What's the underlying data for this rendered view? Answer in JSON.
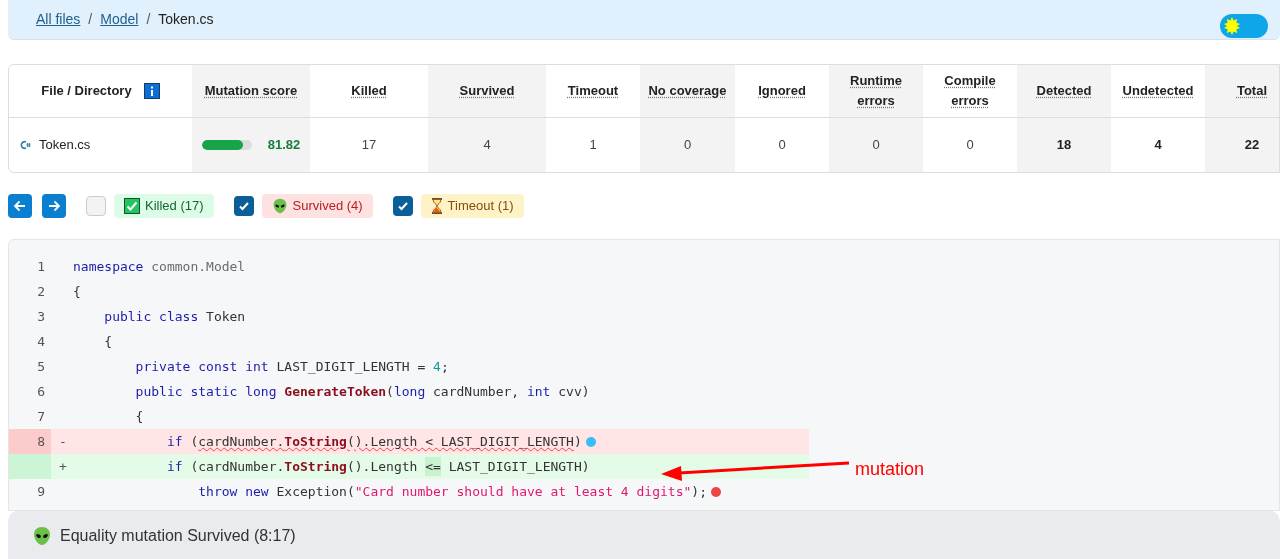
{
  "breadcrumb": [
    {
      "kind": "link",
      "label": "All files"
    },
    {
      "kind": "separator",
      "label": "/"
    },
    {
      "kind": "link",
      "label": "Model"
    },
    {
      "kind": "separator",
      "label": "/"
    },
    {
      "kind": "current",
      "label": "Token.cs"
    }
  ],
  "theme_toggle": {
    "dark": false
  },
  "table": {
    "columns": [
      {
        "label": "File / Directory",
        "info_icon": true
      },
      {
        "label": "Mutation score",
        "info_icon": false
      },
      {
        "label": "Killed",
        "info_icon": false
      },
      {
        "label": "Survived",
        "info_icon": false
      },
      {
        "label": "Timeout",
        "info_icon": false
      },
      {
        "label": "No coverage",
        "info_icon": false
      },
      {
        "label": "Ignored",
        "info_icon": false
      },
      {
        "label": "Runtime errors",
        "info_icon": false
      },
      {
        "label": "Compile errors",
        "info_icon": false
      },
      {
        "label": "Detected",
        "info_icon": false
      },
      {
        "label": "Undetected",
        "info_icon": false
      },
      {
        "label": "Total",
        "info_icon": false
      }
    ],
    "rows": [
      {
        "cells": [
          {
            "kind": "file",
            "text": "Token.cs"
          },
          {
            "kind": "score",
            "text": "81.82",
            "level": 0.8182
          },
          {
            "kind": "count",
            "text": "17",
            "bold": false
          },
          {
            "kind": "count",
            "text": "4",
            "bold": false
          },
          {
            "kind": "count",
            "text": "1",
            "bold": false
          },
          {
            "kind": "count",
            "text": "0",
            "bold": false
          },
          {
            "kind": "count",
            "text": "0",
            "bold": false
          },
          {
            "kind": "count",
            "text": "0",
            "bold": false
          },
          {
            "kind": "count",
            "text": "0",
            "bold": false
          },
          {
            "kind": "count",
            "text": "18",
            "bold": true
          },
          {
            "kind": "count",
            "text": "4",
            "bold": true
          },
          {
            "kind": "count",
            "text": "22",
            "bold": true
          }
        ]
      }
    ]
  },
  "filters": [
    {
      "kind": "killed",
      "label": "Killed (17)",
      "checked": false
    },
    {
      "kind": "survived",
      "label": "Survived (4)",
      "checked": true
    },
    {
      "kind": "timeout",
      "label": "Timeout (1)",
      "checked": true
    }
  ],
  "code": [
    {
      "kind": "context",
      "number": "1",
      "tokens": [
        {
          "text": "namespace",
          "kind": "kw"
        },
        {
          "text": " common.Model",
          "kind": "ns"
        }
      ]
    },
    {
      "kind": "context",
      "number": "2",
      "tokens": [
        {
          "text": "{",
          "kind": "plain"
        }
      ]
    },
    {
      "kind": "context",
      "number": "3",
      "tokens": [
        {
          "text": "    public class",
          "kind": "kw"
        },
        {
          "text": " Token",
          "kind": "plain"
        }
      ]
    },
    {
      "kind": "context",
      "number": "4",
      "tokens": [
        {
          "text": "    {",
          "kind": "plain"
        }
      ]
    },
    {
      "kind": "context",
      "number": "5",
      "tokens": [
        {
          "text": "        private const int",
          "kind": "kw"
        },
        {
          "text": " LAST_DIGIT_LENGTH = ",
          "kind": "plain"
        },
        {
          "text": "4",
          "kind": "num"
        },
        {
          "text": ";",
          "kind": "plain"
        }
      ]
    },
    {
      "kind": "context",
      "number": "6",
      "tokens": [
        {
          "text": "        public static long ",
          "kind": "kw"
        },
        {
          "text": "GenerateToken",
          "kind": "fn"
        },
        {
          "text": "(",
          "kind": "plain"
        },
        {
          "text": "long",
          "kind": "kw"
        },
        {
          "text": " cardNumber, ",
          "kind": "plain"
        },
        {
          "text": "int",
          "kind": "kw"
        },
        {
          "text": " cvv)",
          "kind": "plain"
        }
      ]
    },
    {
      "kind": "context",
      "number": "7",
      "tokens": [
        {
          "text": "        {",
          "kind": "plain"
        }
      ]
    },
    {
      "kind": "removed",
      "number": "8",
      "sign": "-",
      "dot": {
        "color": "#38bdf8"
      },
      "tokens": [
        {
          "text": "            if",
          "kind": "kw"
        },
        {
          "text": " (",
          "kind": "plain"
        },
        {
          "text": "cardNumber.",
          "kind": "plain",
          "underlined": true
        },
        {
          "text": "ToString",
          "kind": "fn",
          "underlined": true
        },
        {
          "text": "().Length < LAST_DIGIT_LENGTH",
          "kind": "plain",
          "underlined": true
        },
        {
          "text": ")",
          "kind": "plain"
        }
      ]
    },
    {
      "kind": "added",
      "sign": "+",
      "tokens": [
        {
          "text": "            if",
          "kind": "kw"
        },
        {
          "text": " (cardNumber.",
          "kind": "plain"
        },
        {
          "text": "ToString",
          "kind": "fn"
        },
        {
          "text": "().Length ",
          "kind": "plain"
        },
        {
          "text": "<=",
          "kind": "changed"
        },
        {
          "text": " LAST_DIGIT_LENGTH)",
          "kind": "plain"
        }
      ]
    },
    {
      "kind": "context",
      "number": "9",
      "dot": {
        "color": "#ef4444"
      },
      "tokens": [
        {
          "text": "                throw new",
          "kind": "kw"
        },
        {
          "text": " Exception(",
          "kind": "plain"
        },
        {
          "text": "\"Card number should have at least 4 digits\"",
          "kind": "str"
        },
        {
          "text": ");",
          "kind": "plain"
        }
      ]
    }
  ],
  "annotation": {
    "text": "mutation"
  },
  "status": {
    "text": "Equality mutation Survived (8:17)"
  }
}
